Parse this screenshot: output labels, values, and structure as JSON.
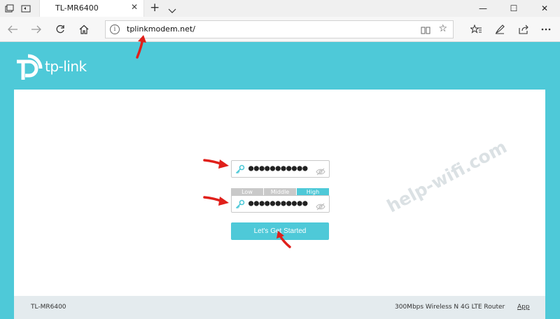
{
  "browser": {
    "tab_title": "TL-MR6400",
    "tab_close": "✕",
    "new_tab": "+",
    "url": "tplinkmodem.net/",
    "window_controls": {
      "minimize": "—",
      "maximize": "☐",
      "close": "✕"
    },
    "icons": [
      "tab-preview-icon",
      "set-aside-tabs-icon",
      "back-icon",
      "forward-icon",
      "refresh-icon",
      "home-icon",
      "site-info-icon",
      "reading-view-icon",
      "favorite-star-icon",
      "favorites-hub-icon",
      "pen-icon",
      "share-icon",
      "more-icon"
    ]
  },
  "router_page": {
    "brand": "tp-link",
    "password_field_1": {
      "masked_value": "●●●●●●●●●●●"
    },
    "strength_meter": {
      "levels": [
        "Low",
        "Middle",
        "High"
      ],
      "active": "High"
    },
    "password_field_2": {
      "masked_value": "●●●●●●●●●●●"
    },
    "start_button": "Let's Get Started",
    "footer": {
      "model": "TL-MR6400",
      "description": "300Mbps Wireless N 4G LTE Router",
      "app_link": "App"
    }
  },
  "watermark": "help-wifi.com",
  "colors": {
    "accent": "#4ec9d8",
    "annotation_arrow": "#e0201b",
    "strength_inactive": "#c9c9c9"
  }
}
